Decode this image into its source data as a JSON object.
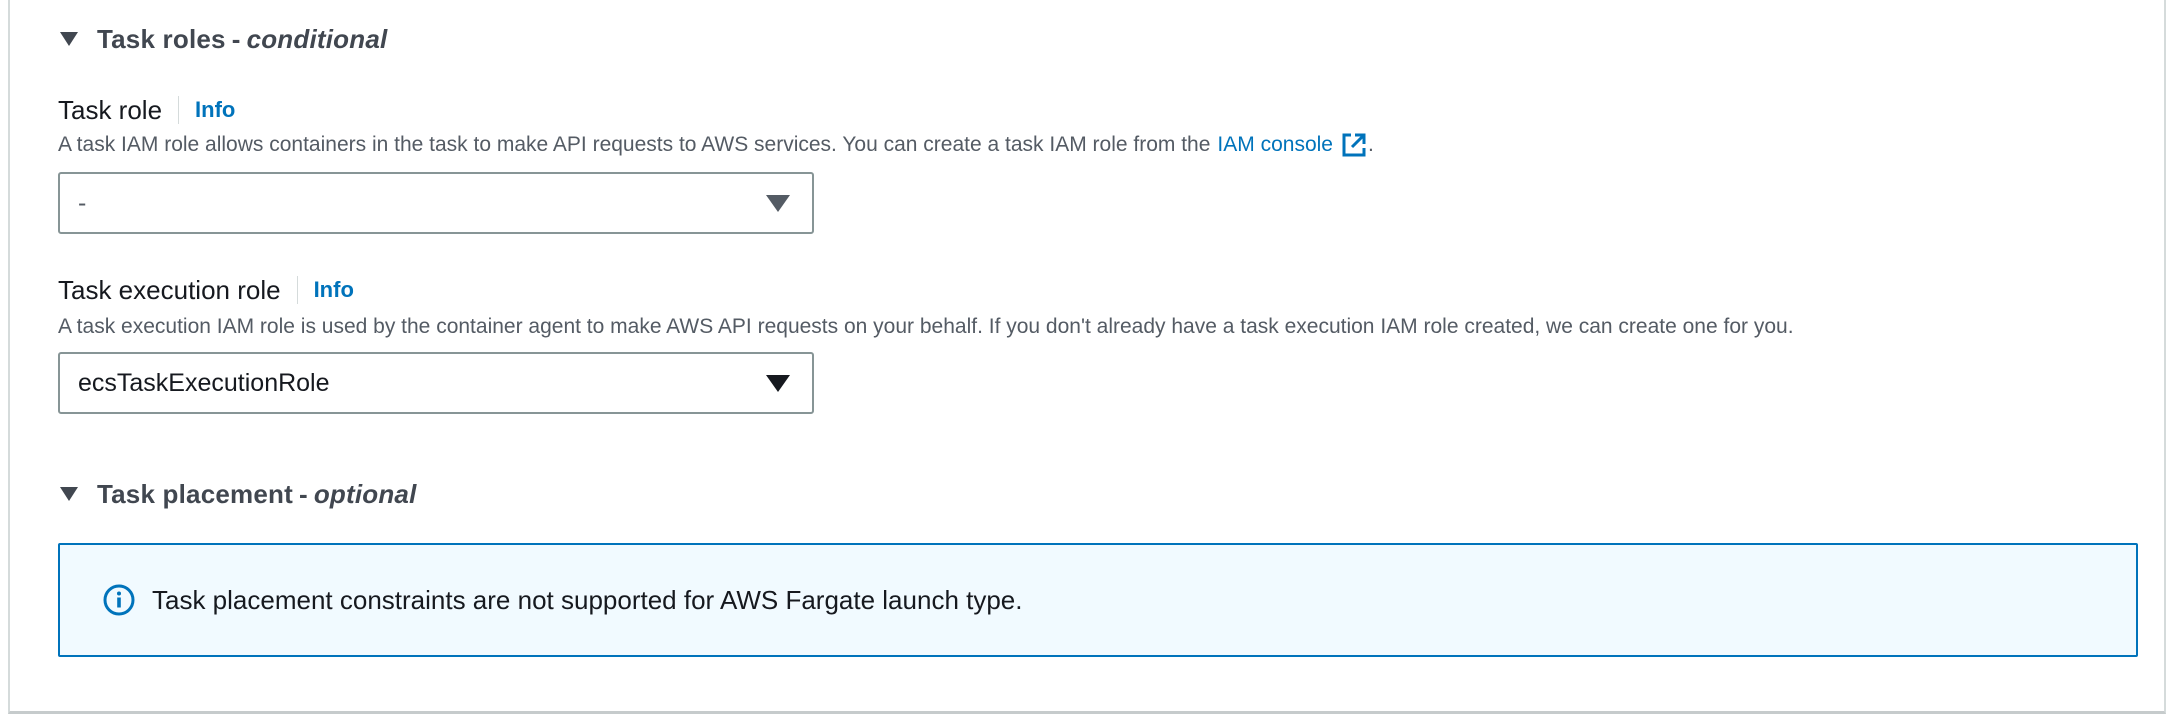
{
  "task_roles": {
    "title": "Task roles",
    "dash": "-",
    "qualifier": "conditional",
    "task_role": {
      "label": "Task role",
      "info": "Info",
      "description": "A task IAM role allows containers in the task to make API requests to AWS services. You can create a task IAM role from the",
      "link": "IAM console",
      "description_end": ".",
      "selected": "-"
    },
    "execution_role": {
      "label": "Task execution role",
      "info": "Info",
      "description": "A task execution IAM role is used by the container agent to make AWS API requests on your behalf. If you don't already have a task execution IAM role created, we can create one for you.",
      "selected": "ecsTaskExecutionRole"
    }
  },
  "task_placement": {
    "title": "Task placement",
    "dash": "-",
    "qualifier": "optional",
    "alert": "Task placement constraints are not supported for AWS Fargate launch type."
  },
  "colors": {
    "link": "#0073bb",
    "alert_border": "#0073bb",
    "alert_bg": "#f1faff"
  },
  "icons": {
    "section_toggle": "caret-down-icon",
    "external": "external-link-icon",
    "info": "info-circle-icon",
    "dropdown": "dropdown-caret-icon"
  }
}
